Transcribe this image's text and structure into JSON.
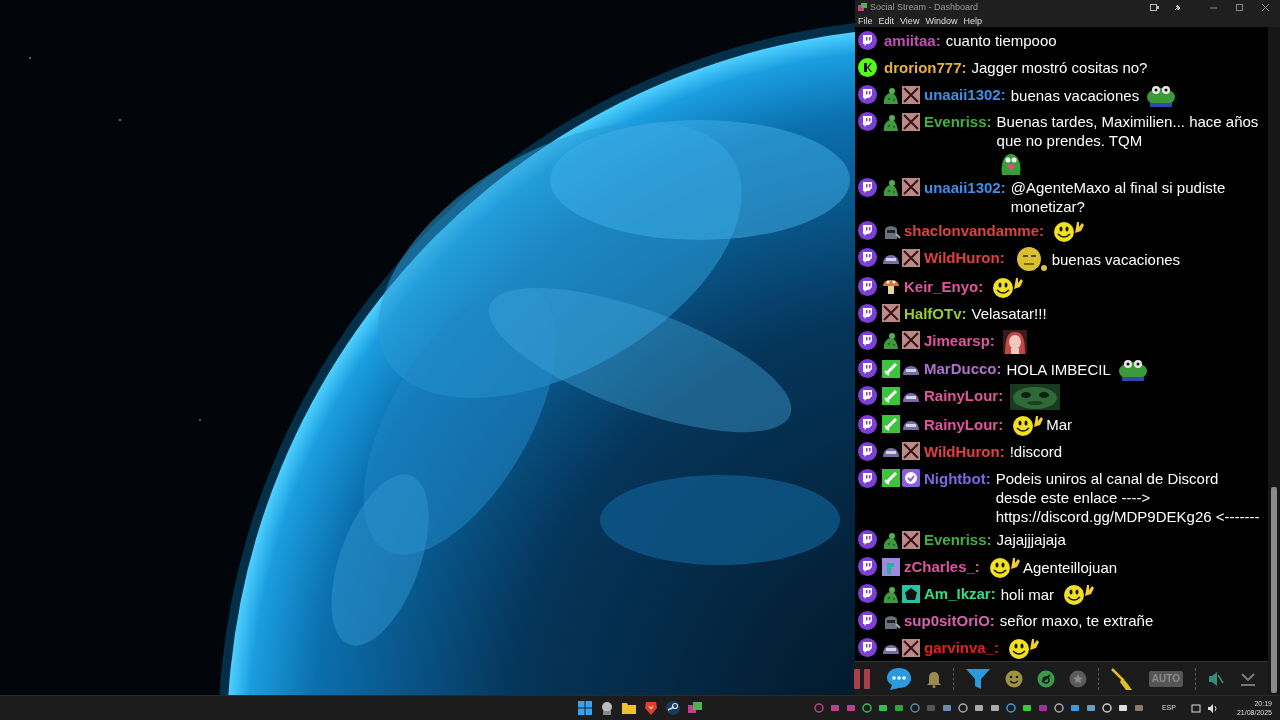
{
  "window": {
    "title": "Social Stream - Dashboard"
  },
  "menu": [
    "File",
    "Edit",
    "View",
    "Window",
    "Help"
  ],
  "messages": [
    {
      "kind": "twitch",
      "user": "amiitaa:",
      "color": "#c050b8",
      "parts": [
        {
          "kind": "text",
          "text": "cuanto tiempooo"
        }
      ]
    },
    {
      "kind": "kick",
      "user": "drorion777:",
      "color": "#e8b040",
      "parts": [
        {
          "kind": "text",
          "text": "Jagger mostró cositas no?"
        }
      ]
    },
    {
      "kind": "twitch",
      "badges": [
        {
          "kind": "creature"
        },
        {
          "kind": "crossed"
        }
      ],
      "user": "unaaii1302:",
      "color": "#3d8fe8",
      "parts": [
        {
          "kind": "text",
          "text": "buenas vacaciones"
        },
        {
          "kind": "frog"
        }
      ]
    },
    {
      "kind": "twitch",
      "badges": [
        {
          "kind": "creature"
        },
        {
          "kind": "crossed"
        }
      ],
      "user": "Evenriss:",
      "color": "#3fb03f",
      "parts": [
        {
          "kind": "text",
          "text": "Buenas tardes, Maximilien... hace años que no prendes. TQM"
        },
        {
          "kind": "monster"
        }
      ]
    },
    {
      "kind": "twitch",
      "badges": [
        {
          "kind": "creature"
        },
        {
          "kind": "crossed"
        }
      ],
      "user": "unaaii1302:",
      "color": "#3d8fe8",
      "parts": [
        {
          "kind": "text",
          "text": "@AgenteMaxo al final si pudiste monetizar?"
        }
      ]
    },
    {
      "kind": "twitch",
      "badges": [
        {
          "kind": "helmet"
        }
      ],
      "user": "shaclonvandamme:",
      "color": "#e04040",
      "parts": [
        {
          "kind": "wave"
        }
      ]
    },
    {
      "kind": "twitch",
      "badges": [
        {
          "kind": "dome"
        },
        {
          "kind": "crossed"
        }
      ],
      "user": "WildHuron:",
      "color": "#e04040",
      "parts": [
        {
          "kind": "smiley"
        },
        {
          "kind": "text",
          "text": "buenas vacaciones"
        }
      ]
    },
    {
      "kind": "twitch",
      "badges": [
        {
          "kind": "mushroom"
        }
      ],
      "user": "Keir_Enyo:",
      "color": "#e0559e",
      "parts": [
        {
          "kind": "wave"
        }
      ]
    },
    {
      "kind": "twitch",
      "badges": [
        {
          "kind": "crossed"
        }
      ],
      "user": "HalfOTv:",
      "color": "#9acd32",
      "parts": [
        {
          "kind": "text",
          "text": "Velasatar!!!"
        }
      ]
    },
    {
      "kind": "twitch",
      "badges": [
        {
          "kind": "creature"
        },
        {
          "kind": "crossed"
        }
      ],
      "user": "Jimearsp:",
      "color": "#e0559e",
      "parts": [
        {
          "kind": "character"
        }
      ]
    },
    {
      "kind": "twitch",
      "badges": [
        {
          "kind": "sword"
        },
        {
          "kind": "dome"
        }
      ],
      "user": "MarDucco:",
      "color": "#b070d0",
      "parts": [
        {
          "kind": "text",
          "text": "HOLA IMBECIL"
        },
        {
          "kind": "frog"
        }
      ]
    },
    {
      "kind": "twitch",
      "badges": [
        {
          "kind": "sword"
        },
        {
          "kind": "dome"
        }
      ],
      "user": "RainyLour:",
      "color": "#e0559e",
      "parts": [
        {
          "kind": "mask"
        }
      ]
    },
    {
      "kind": "twitch",
      "badges": [
        {
          "kind": "sword"
        },
        {
          "kind": "dome"
        }
      ],
      "user": "RainyLour:",
      "color": "#e0559e",
      "parts": [
        {
          "kind": "wave"
        },
        {
          "kind": "text",
          "text": "Mar"
        }
      ]
    },
    {
      "kind": "twitch",
      "badges": [
        {
          "kind": "dome"
        },
        {
          "kind": "crossed"
        }
      ],
      "user": "WildHuron:",
      "color": "#e04040",
      "parts": [
        {
          "kind": "text",
          "text": "!discord"
        }
      ]
    },
    {
      "kind": "twitch",
      "badges": [
        {
          "kind": "sword"
        },
        {
          "kind": "verified"
        }
      ],
      "user": "Nightbot:",
      "color": "#7a6ae6",
      "parts": [
        {
          "kind": "text",
          "text": "Podeis uniros al canal de Discord desde este enlace ----> https://discord.gg/MDP9DEKg26 <-------"
        }
      ]
    },
    {
      "kind": "twitch",
      "badges": [
        {
          "kind": "creature"
        },
        {
          "kind": "crossed"
        }
      ],
      "user": "Evenriss:",
      "color": "#3fb03f",
      "parts": [
        {
          "kind": "text",
          "text": "Jajajjjajaja"
        }
      ]
    },
    {
      "kind": "twitch",
      "badges": [
        {
          "kind": "dino"
        }
      ],
      "user": "zCharles_:",
      "color": "#e0559e",
      "parts": [
        {
          "kind": "wave"
        },
        {
          "kind": "text",
          "text": "Agenteillojuan"
        }
      ]
    },
    {
      "kind": "twitch",
      "badges": [
        {
          "kind": "creature"
        },
        {
          "kind": "pentagon"
        }
      ],
      "user": "Am_Ikzar:",
      "color": "#30e080",
      "parts": [
        {
          "kind": "text",
          "text": "holi mar"
        },
        {
          "kind": "wave"
        }
      ]
    },
    {
      "kind": "twitch",
      "badges": [
        {
          "kind": "helmet"
        }
      ],
      "user": "sup0sitOriO:",
      "color": "#d860b0",
      "parts": [
        {
          "kind": "text",
          "text": "señor maxo, te extrañe"
        }
      ]
    },
    {
      "kind": "twitch",
      "badges": [
        {
          "kind": "dome"
        },
        {
          "kind": "crossed"
        }
      ],
      "user": "garvinva_:",
      "color": "#e02020",
      "parts": [
        {
          "kind": "wave"
        }
      ]
    }
  ],
  "toolbar": [
    {
      "kind": "pause"
    },
    {
      "kind": "chat"
    },
    {
      "kind": "bell"
    },
    {
      "kind": "separator"
    },
    {
      "kind": "filter"
    },
    {
      "kind": "emoji"
    },
    {
      "kind": "circle"
    },
    {
      "kind": "star"
    },
    {
      "kind": "separator"
    },
    {
      "kind": "broom"
    },
    {
      "kind": "auto",
      "label": "AUTO"
    },
    {
      "kind": "separator"
    },
    {
      "kind": "mute"
    },
    {
      "kind": "download"
    }
  ],
  "taskbar": {
    "apps": [
      {
        "kind": "start"
      },
      {
        "kind": "app"
      },
      {
        "kind": "folder"
      },
      {
        "kind": "shield"
      },
      {
        "kind": "steam"
      },
      {
        "kind": "stream"
      }
    ],
    "language": "ESP",
    "time": "20:19",
    "date": "21/08/2025"
  }
}
